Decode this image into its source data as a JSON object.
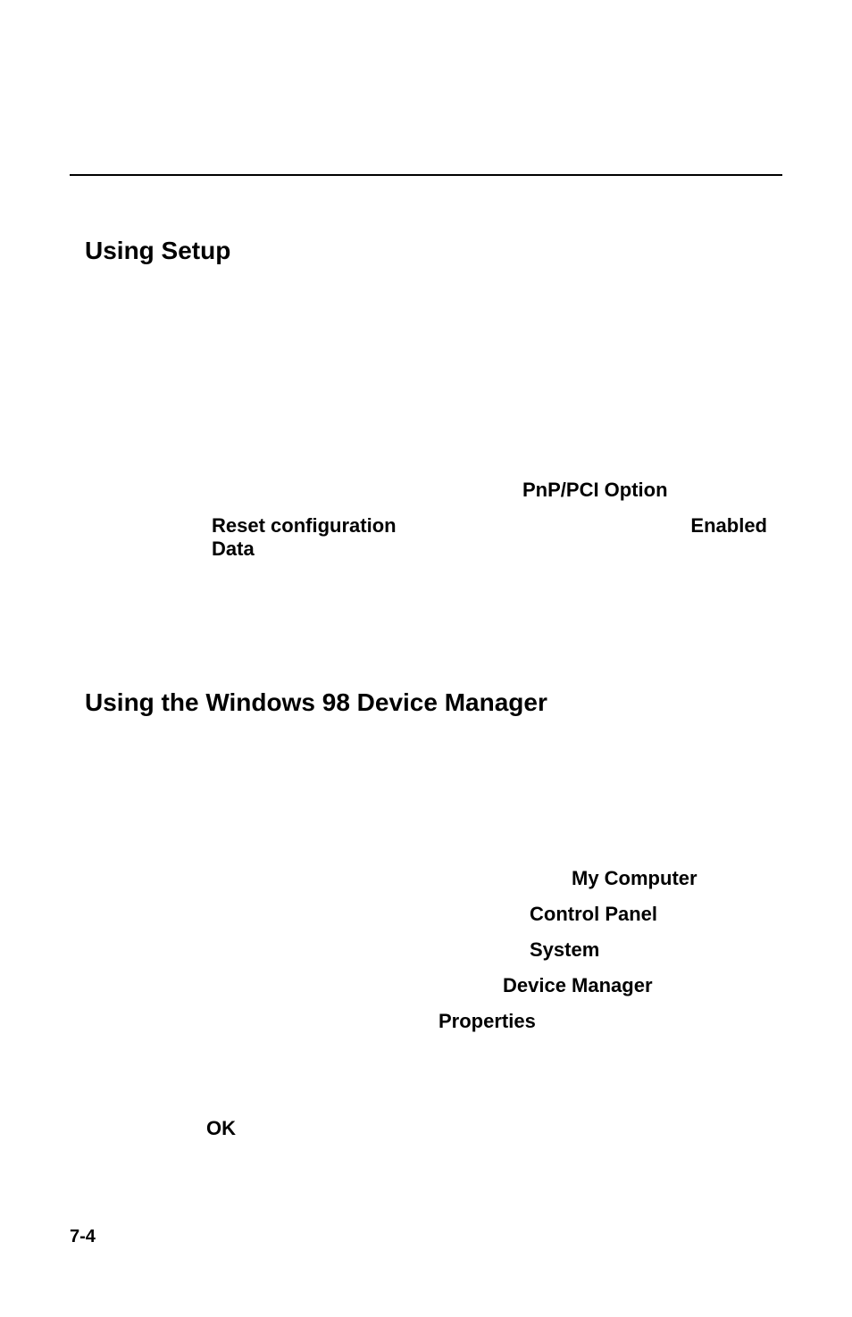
{
  "section1": {
    "heading": "Using Setup",
    "pnp_label": "PnP/PCI Option",
    "reset_label": "Reset configuration Data",
    "enabled_label": "Enabled"
  },
  "section2": {
    "heading": "Using the Windows 98 Device Manager",
    "steps": {
      "my_computer": "My Computer",
      "control_panel": "Control Panel",
      "system": "System",
      "device_manager": "Device Manager",
      "properties": "Properties",
      "ok": "OK"
    }
  },
  "footer": {
    "page_number": "7-4"
  }
}
